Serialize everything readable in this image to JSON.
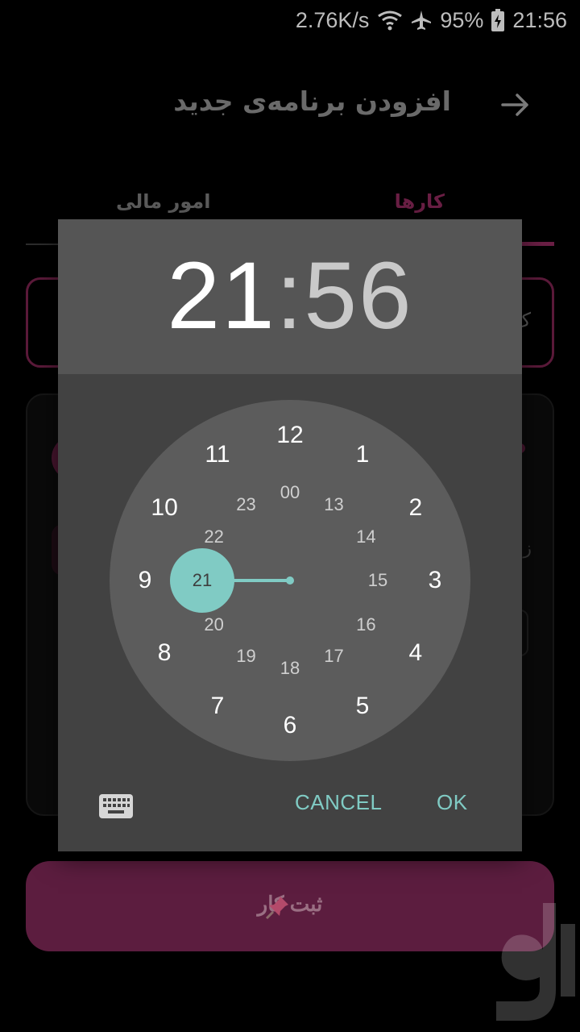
{
  "status_bar": {
    "net_speed": "2.76K/s",
    "battery": "95%",
    "time": "21:56"
  },
  "header": {
    "title": "افزودن برنامه‌ی جدید"
  },
  "tabs": [
    {
      "label": "کارها",
      "active": true
    },
    {
      "label": "امور مالی",
      "active": false
    }
  ],
  "form": {
    "submit_label": "ثبت کار",
    "field_hint_char": "ک",
    "card_hint_char": "ز"
  },
  "time_picker": {
    "hour": "21",
    "separator": ":",
    "minute": "56",
    "selected_hour": "21",
    "outer_hours": [
      "12",
      "1",
      "2",
      "3",
      "4",
      "5",
      "6",
      "7",
      "8",
      "9",
      "10",
      "11"
    ],
    "inner_hours": [
      "00",
      "13",
      "14",
      "15",
      "16",
      "17",
      "18",
      "19",
      "20",
      "21",
      "22",
      "23"
    ],
    "cancel_label": "CANCEL",
    "ok_label": "OK",
    "accent_color": "#80cbc4"
  },
  "icons": {
    "back": "arrow-right-icon",
    "keyboard": "keyboard-icon",
    "pin": "pushpin-icon",
    "wifi": "wifi-icon",
    "airplane": "airplane-icon",
    "battery": "battery-charging-icon"
  }
}
